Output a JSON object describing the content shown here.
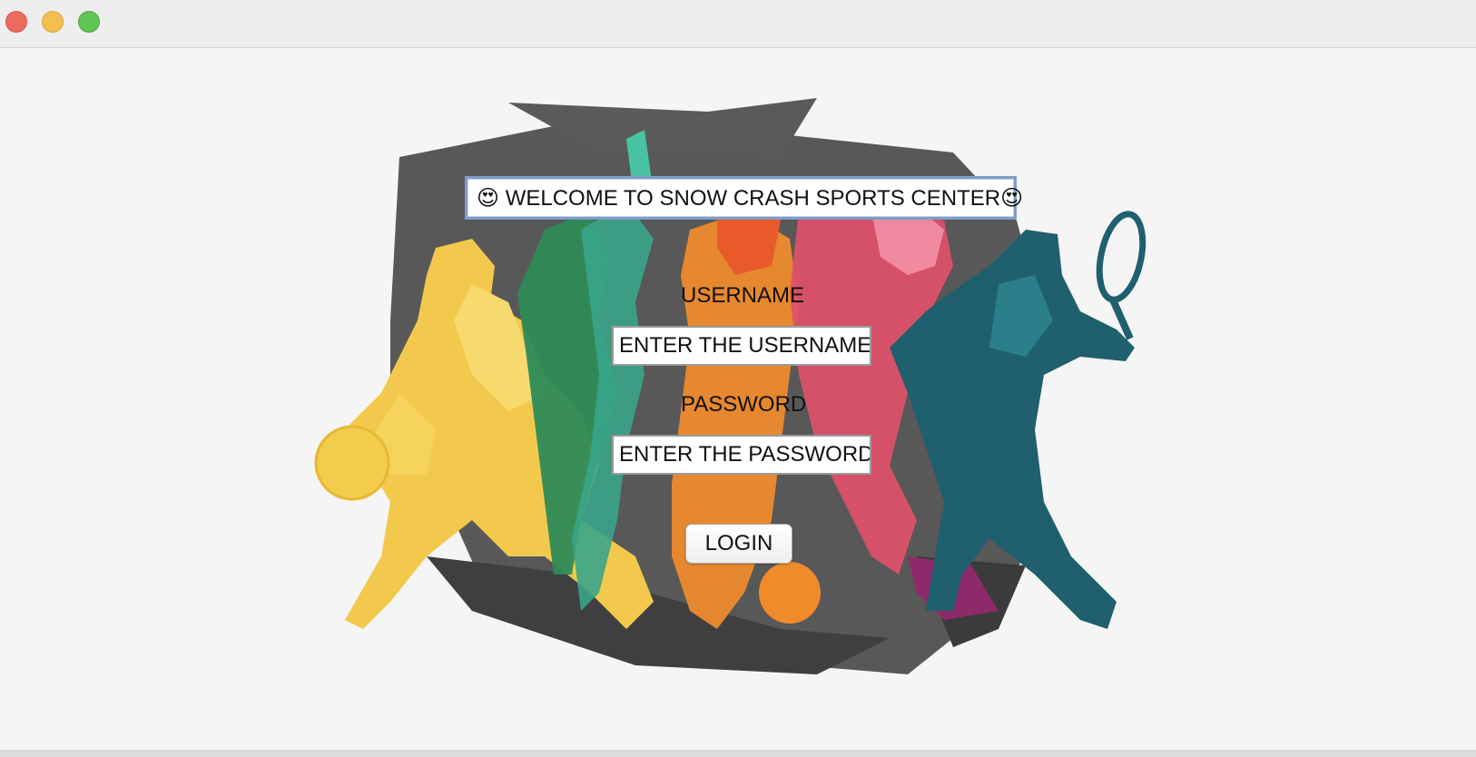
{
  "window": {
    "controls": [
      "close",
      "minimize",
      "maximize"
    ]
  },
  "banner": {
    "text": "😍 WELCOME TO SNOW CRASH SPORTS CENTER😍"
  },
  "form": {
    "username_label": "USERNAME",
    "username_value": "ENTER THE USERNAME",
    "password_label": "PASSWORD",
    "password_value": "ENTER THE PASSWORD",
    "login_label": "LOGIN"
  },
  "artwork": {
    "description_icon": "sports-silhouettes-illustration"
  },
  "colors": {
    "close": "#ed6a5e",
    "minimize": "#f5bf4f",
    "maximize": "#61c554",
    "field_border_focus": "#7f9dc6"
  }
}
